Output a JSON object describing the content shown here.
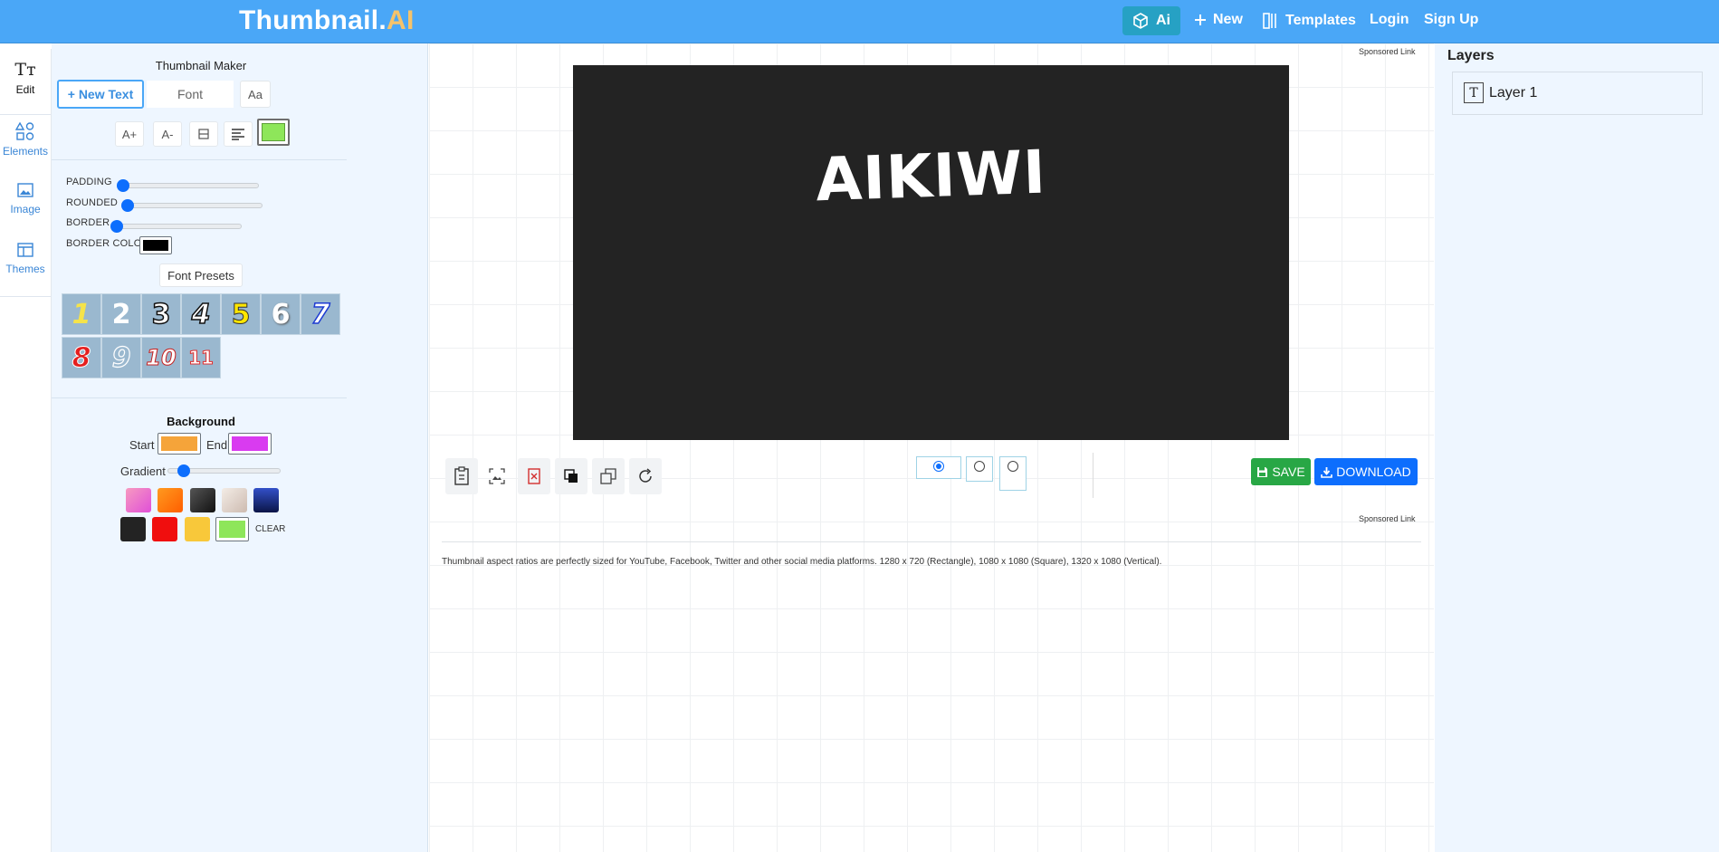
{
  "header": {
    "brand_main": "Thumbnail.",
    "brand_accent": "AI",
    "ai_label": "Ai",
    "new_label": "New",
    "templates_label": "Templates",
    "login_label": "Login",
    "signup_label": "Sign Up"
  },
  "rail": {
    "items": [
      {
        "label": "Edit",
        "icon": "text-icon"
      },
      {
        "label": "Elements",
        "icon": "shapes-icon"
      },
      {
        "label": "Image",
        "icon": "image-icon"
      },
      {
        "label": "Themes",
        "icon": "layout-icon"
      }
    ],
    "edit_glyph": "Tт"
  },
  "panel": {
    "title": "Thumbnail Maker",
    "new_text": "+ New Text",
    "font": "Font",
    "aa": "Aa",
    "size_up": "A+",
    "size_down": "A-",
    "text_color": "#8ee65a",
    "sliders": {
      "padding": "PADDING",
      "rounded": "ROUNDED",
      "border": "BORDER",
      "border_color": "BORDER COLOR"
    },
    "border_color_value": "#000000",
    "font_presets": "Font Presets",
    "presets": [
      "1",
      "2",
      "3",
      "4",
      "5",
      "6",
      "7",
      "8",
      "9",
      "10",
      "11"
    ],
    "background": {
      "title": "Background",
      "start": "Start",
      "end": "End",
      "start_color": "#f5a43a",
      "end_color": "#d93bf0",
      "gradient": "Gradient",
      "clear": "CLEAR"
    }
  },
  "stage": {
    "sponsored": "Sponsored Link",
    "canvas_text": "AIKIWI",
    "save": "SAVE",
    "download": "DOWNLOAD",
    "info": "Thumbnail aspect ratios are perfectly sized for YouTube, Facebook, Twitter and other social media platforms. 1280 x 720 (Rectangle), 1080 x 1080 (Square), 1320 x 1080 (Vertical)."
  },
  "layers": {
    "title": "Layers",
    "items": [
      {
        "name": "Layer 1",
        "icon": "T"
      }
    ]
  }
}
